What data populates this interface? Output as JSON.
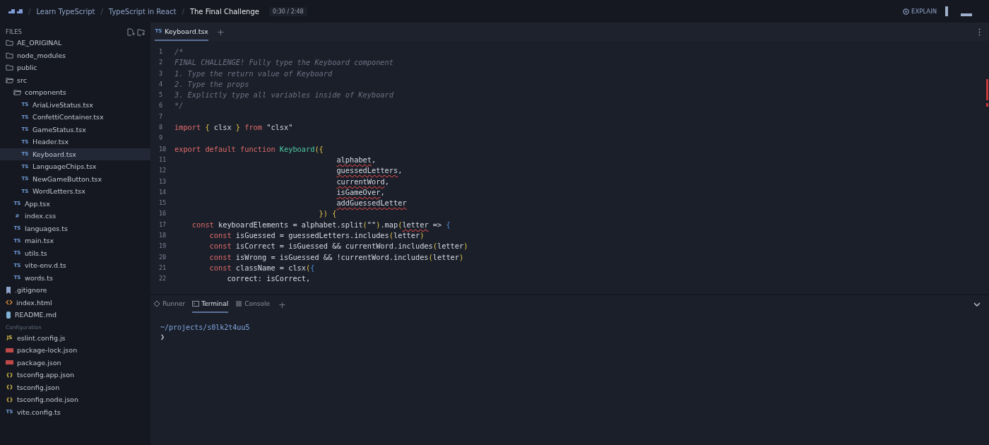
{
  "topbar": {
    "breadcrumbs": [
      {
        "label": "Learn TypeScript",
        "current": false
      },
      {
        "label": "TypeScript in React",
        "current": false
      },
      {
        "label": "The Final Challenge",
        "current": true
      }
    ],
    "separator": "/",
    "timer": "0:30 / 2:48",
    "explain": "EXPLAIN"
  },
  "sidebar": {
    "title": "FILES",
    "sections": [
      {
        "items": [
          {
            "name": "AE_ORIGINAL",
            "kind": "folder",
            "expanded": false,
            "selected": false
          },
          {
            "name": "node_modules",
            "kind": "folder",
            "expanded": false,
            "selected": false
          },
          {
            "name": "public",
            "kind": "folder",
            "expanded": false,
            "selected": false
          },
          {
            "name": "src",
            "kind": "folder",
            "expanded": true,
            "selected": false,
            "children": [
              {
                "name": "components",
                "kind": "folder",
                "expanded": true,
                "selected": false,
                "children": [
                  {
                    "name": "AriaLiveStatus.tsx",
                    "kind": "ts",
                    "badge": "TS",
                    "selected": false
                  },
                  {
                    "name": "ConfettiContainer.tsx",
                    "kind": "ts",
                    "badge": "TS",
                    "selected": false
                  },
                  {
                    "name": "GameStatus.tsx",
                    "kind": "ts",
                    "badge": "TS",
                    "selected": false
                  },
                  {
                    "name": "Header.tsx",
                    "kind": "ts",
                    "badge": "TS",
                    "selected": false
                  },
                  {
                    "name": "Keyboard.tsx",
                    "kind": "ts",
                    "badge": "TS",
                    "selected": true
                  },
                  {
                    "name": "LanguageChips.tsx",
                    "kind": "ts",
                    "badge": "TS",
                    "selected": false
                  },
                  {
                    "name": "NewGameButton.tsx",
                    "kind": "ts",
                    "badge": "TS",
                    "selected": false
                  },
                  {
                    "name": "WordLetters.tsx",
                    "kind": "ts",
                    "badge": "TS",
                    "selected": false
                  }
                ]
              },
              {
                "name": "App.tsx",
                "kind": "ts",
                "badge": "TS",
                "selected": false
              },
              {
                "name": "index.css",
                "kind": "css",
                "badge": "#",
                "selected": false
              },
              {
                "name": "languages.ts",
                "kind": "ts",
                "badge": "TS",
                "selected": false
              },
              {
                "name": "main.tsx",
                "kind": "ts",
                "badge": "TS",
                "selected": false
              },
              {
                "name": "utils.ts",
                "kind": "ts",
                "badge": "TS",
                "selected": false
              },
              {
                "name": "vite-env.d.ts",
                "kind": "ts",
                "badge": "TS",
                "selected": false
              },
              {
                "name": "words.ts",
                "kind": "ts",
                "badge": "TS",
                "selected": false
              }
            ]
          },
          {
            "name": ".gitignore",
            "kind": "git",
            "selected": false
          },
          {
            "name": "index.html",
            "kind": "html",
            "selected": false
          },
          {
            "name": "README.md",
            "kind": "md",
            "selected": false
          }
        ]
      },
      {
        "title": "Configuration",
        "items": [
          {
            "name": "eslint.config.js",
            "kind": "js",
            "badge": "JS",
            "selected": false
          },
          {
            "name": "package-lock.json",
            "kind": "npm",
            "selected": false
          },
          {
            "name": "package.json",
            "kind": "npm",
            "selected": false
          },
          {
            "name": "tsconfig.app.json",
            "kind": "json",
            "badge": "{}",
            "selected": false
          },
          {
            "name": "tsconfig.json",
            "kind": "json",
            "badge": "{}",
            "selected": false
          },
          {
            "name": "tsconfig.node.json",
            "kind": "json",
            "badge": "{}",
            "selected": false
          },
          {
            "name": "vite.config.ts",
            "kind": "ts",
            "badge": "TS",
            "selected": false
          }
        ]
      }
    ]
  },
  "editor": {
    "tabs": [
      {
        "badge": "TS",
        "label": "Keyboard.tsx",
        "selected": true
      }
    ],
    "add": "+",
    "lines": [
      {
        "number": "1",
        "tokens": [
          {
            "kind": "comment",
            "text": "/*"
          }
        ]
      },
      {
        "number": "2",
        "tokens": [
          {
            "kind": "comment",
            "text": "FINAL CHALLENGE! Fully type the Keyboard component"
          }
        ]
      },
      {
        "number": "3",
        "tokens": [
          {
            "kind": "comment",
            "text": "1. Type the return value of Keyboard"
          }
        ]
      },
      {
        "number": "4",
        "tokens": [
          {
            "kind": "comment",
            "text": "2. Type the props"
          }
        ]
      },
      {
        "number": "5",
        "tokens": [
          {
            "kind": "comment",
            "text": "3. Explictly type all variables inside of Keyboard"
          }
        ]
      },
      {
        "number": "6",
        "tokens": [
          {
            "kind": "comment",
            "text": "*/"
          }
        ]
      },
      {
        "number": "7"
      },
      {
        "number": "8",
        "tokens": [
          {
            "kind": "keyword",
            "text": "import "
          },
          {
            "kind": "brace",
            "text": "{ "
          },
          {
            "kind": "plain",
            "text": "clsx "
          },
          {
            "kind": "brace",
            "text": "} "
          },
          {
            "kind": "keyword",
            "text": "from "
          },
          {
            "kind": "plain",
            "text": "\"clsx\""
          }
        ]
      },
      {
        "number": "9"
      },
      {
        "number": "10",
        "tokens": [
          {
            "kind": "keyword",
            "text": "export default function "
          },
          {
            "kind": "name",
            "text": "Keyboard"
          },
          {
            "kind": "brace",
            "text": "({"
          }
        ]
      },
      {
        "number": "11",
        "kind": "param",
        "tokens": [
          {
            "kind": "error",
            "text": "alphabet"
          },
          {
            "kind": "plain",
            "text": ","
          }
        ]
      },
      {
        "number": "12",
        "kind": "param",
        "tokens": [
          {
            "kind": "error",
            "text": "guessedLetters"
          },
          {
            "kind": "plain",
            "text": ","
          }
        ]
      },
      {
        "number": "13",
        "kind": "param",
        "tokens": [
          {
            "kind": "error",
            "text": "currentWord"
          },
          {
            "kind": "plain",
            "text": ","
          }
        ]
      },
      {
        "number": "14",
        "kind": "param",
        "tokens": [
          {
            "kind": "error",
            "text": "isGameOver"
          },
          {
            "kind": "plain",
            "text": ","
          }
        ]
      },
      {
        "number": "15",
        "kind": "param",
        "tokens": [
          {
            "kind": "error",
            "text": "addGuessedLetter"
          }
        ]
      },
      {
        "number": "16",
        "kind": "close",
        "tokens": [
          {
            "kind": "brace",
            "text": "}) {"
          }
        ]
      },
      {
        "number": "17",
        "kind": "body",
        "tokens": [
          {
            "kind": "keyword",
            "text": "const "
          },
          {
            "kind": "plain",
            "text": "keyboardElements = alphabet.split"
          },
          {
            "kind": "brace",
            "text": "("
          },
          {
            "kind": "plain",
            "text": "\"\""
          },
          {
            "kind": "brace",
            "text": ")"
          },
          {
            "kind": "plain",
            "text": ".map"
          },
          {
            "kind": "brace",
            "text": "("
          },
          {
            "kind": "error",
            "text": "letter"
          },
          {
            "kind": "plain",
            "text": " => "
          },
          {
            "kind": "bracket",
            "text": "{"
          }
        ]
      },
      {
        "number": "18",
        "kind": "inner",
        "tokens": [
          {
            "kind": "keyword",
            "text": "const "
          },
          {
            "kind": "plain",
            "text": "isGuessed = guessedLetters.includes"
          },
          {
            "kind": "brace",
            "text": "("
          },
          {
            "kind": "plain",
            "text": "letter"
          },
          {
            "kind": "brace",
            "text": ")"
          }
        ]
      },
      {
        "number": "19",
        "kind": "inner",
        "tokens": [
          {
            "kind": "keyword",
            "text": "const "
          },
          {
            "kind": "plain",
            "text": "isCorrect = isGuessed && currentWord.includes"
          },
          {
            "kind": "brace",
            "text": "("
          },
          {
            "kind": "plain",
            "text": "letter"
          },
          {
            "kind": "brace",
            "text": ")"
          }
        ]
      },
      {
        "number": "20",
        "kind": "inner",
        "tokens": [
          {
            "kind": "keyword",
            "text": "const "
          },
          {
            "kind": "plain",
            "text": "isWrong = isGuessed && !currentWord.includes"
          },
          {
            "kind": "brace",
            "text": "("
          },
          {
            "kind": "plain",
            "text": "letter"
          },
          {
            "kind": "brace",
            "text": ")"
          }
        ]
      },
      {
        "number": "21",
        "kind": "inner",
        "tokens": [
          {
            "kind": "keyword",
            "text": "const "
          },
          {
            "kind": "plain",
            "text": "className = clsx"
          },
          {
            "kind": "brace",
            "text": "("
          },
          {
            "kind": "bracket",
            "text": "{"
          }
        ]
      },
      {
        "number": "22",
        "kind": "deep",
        "tokens": [
          {
            "kind": "plain",
            "text": "correct: isCorrect,"
          }
        ]
      }
    ]
  },
  "panel": {
    "tabs": [
      {
        "kind": "runner",
        "label": "Runner",
        "selected": false
      },
      {
        "kind": "terminal",
        "label": "Terminal",
        "selected": true
      },
      {
        "kind": "console",
        "label": "Console",
        "selected": false
      }
    ],
    "add": "+",
    "terminal": [
      {
        "kind": "path",
        "text": "~/projects/s0lk2t4uu5"
      },
      {
        "kind": "prompt",
        "text": "❯"
      }
    ]
  }
}
